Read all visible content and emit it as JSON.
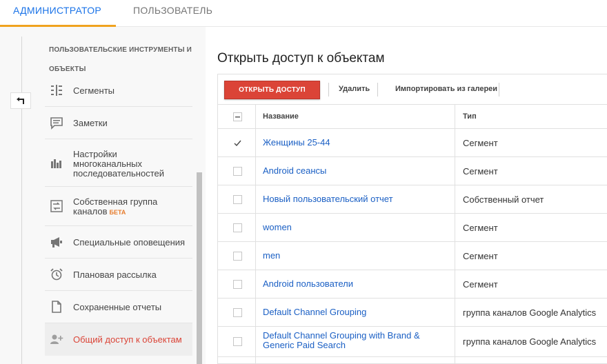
{
  "tabs": {
    "admin": "АДМИНИСТРАТОР",
    "user": "ПОЛЬЗОВАТЕЛЬ"
  },
  "sidebar": {
    "section_tools": "ПОЛЬЗОВАТЕЛЬСКИЕ ИНСТРУМЕНТЫ И",
    "section_objects": "ОБЪЕКТЫ",
    "items": [
      {
        "label": "Сегменты",
        "icon": "segments-icon"
      },
      {
        "label": "Заметки",
        "icon": "notes-icon"
      },
      {
        "label": "Настройки многоканальных последовательностей",
        "icon": "multichannel-icon"
      },
      {
        "label": "Собственная группа каналов",
        "beta": "БЕТА",
        "icon": "channel-group-icon"
      },
      {
        "label": "Специальные оповещения",
        "icon": "megaphone-icon"
      },
      {
        "label": "Плановая рассылка",
        "icon": "alarm-clock-icon"
      },
      {
        "label": "Сохраненные отчеты",
        "icon": "saved-report-icon"
      },
      {
        "label": "Общий доступ к объектам",
        "icon": "add-person-icon",
        "active": true
      }
    ]
  },
  "main": {
    "title": "Открыть доступ к объектам",
    "toolbar": {
      "share_label": "ОТКРЫТЬ ДОСТУП",
      "delete_label": "Удалить",
      "import_label": "Импортировать из галереи"
    },
    "table": {
      "columns": [
        "Название",
        "Тип"
      ],
      "rows": [
        {
          "name": "Женщины 25-44",
          "type": "Сегмент",
          "checked": true
        },
        {
          "name": "Android сеансы",
          "type": "Сегмент",
          "checked": false
        },
        {
          "name": "Новый пользовательский отчет",
          "type": "Собственный отчет",
          "checked": false
        },
        {
          "name": "women",
          "type": "Сегмент",
          "checked": false
        },
        {
          "name": "men",
          "type": "Сегмент",
          "checked": false
        },
        {
          "name": "Android пользователи",
          "type": "Сегмент",
          "checked": false
        },
        {
          "name": "Default Channel Grouping",
          "type": "группа каналов Google Analytics",
          "checked": false
        },
        {
          "name": "Default Channel Grouping with Brand & Generic Paid Search",
          "type": "группа каналов Google Analytics",
          "checked": false
        }
      ]
    }
  },
  "colors": {
    "accent_blue": "#1a73e8",
    "tab_underline": "#f0a21e",
    "share_button": "#db4437",
    "link": "#1a5fc4",
    "beta": "#e67c2e"
  }
}
